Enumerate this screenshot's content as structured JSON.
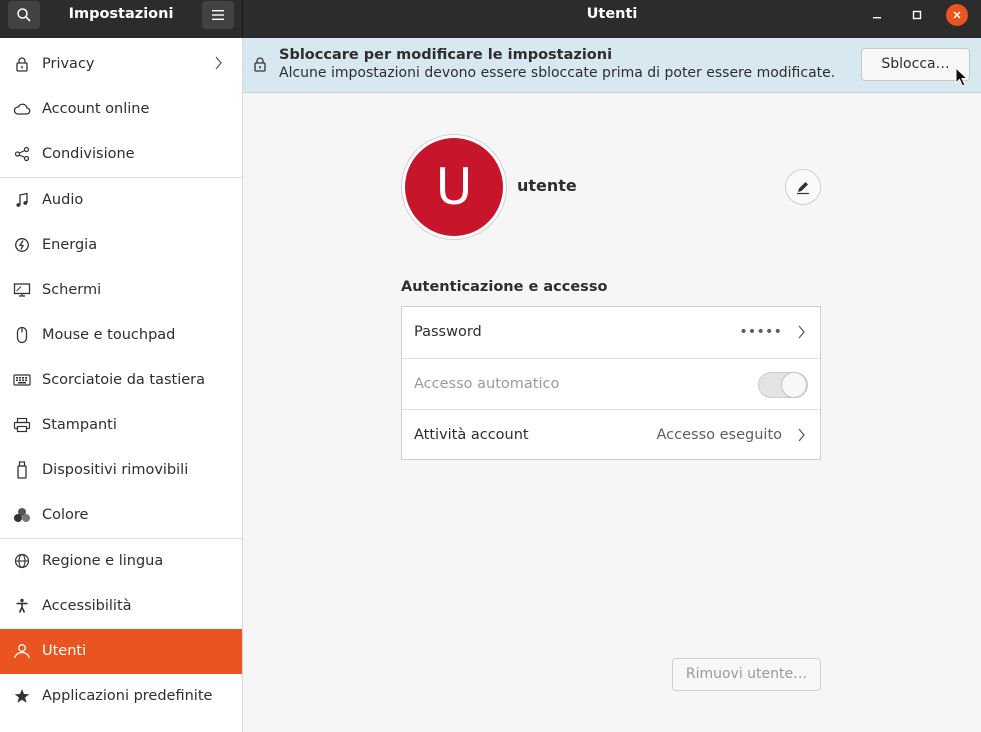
{
  "header": {
    "sidebar_title": "Impostazioni",
    "title": "Utenti",
    "search_icon": "search-icon",
    "menu_icon": "hamburger-menu-icon"
  },
  "sidebar": {
    "items": [
      {
        "label": "Privacy",
        "icon": "lock-icon",
        "has_chevron": true
      },
      {
        "label": "Account online",
        "icon": "cloud-icon"
      },
      {
        "label": "Condivisione",
        "icon": "share-icon"
      },
      {
        "label": "Audio",
        "icon": "music-note-icon"
      },
      {
        "label": "Energia",
        "icon": "power-icon"
      },
      {
        "label": "Schermi",
        "icon": "display-icon"
      },
      {
        "label": "Mouse e touchpad",
        "icon": "mouse-icon"
      },
      {
        "label": "Scorciatoie da tastiera",
        "icon": "keyboard-icon"
      },
      {
        "label": "Stampanti",
        "icon": "printer-icon"
      },
      {
        "label": "Dispositivi rimovibili",
        "icon": "usb-drive-icon"
      },
      {
        "label": "Colore",
        "icon": "color-circles-icon"
      },
      {
        "label": "Regione e lingua",
        "icon": "globe-icon"
      },
      {
        "label": "Accessibilità",
        "icon": "accessibility-icon"
      },
      {
        "label": "Utenti",
        "icon": "users-icon",
        "active": true
      },
      {
        "label": "Applicazioni predefinite",
        "icon": "star-icon"
      }
    ]
  },
  "infobar": {
    "title": "Sbloccare per modificare le impostazioni",
    "subtitle": "Alcune impostazioni devono essere sbloccate prima di poter essere modificate.",
    "unlock_label": "Sblocca…"
  },
  "user": {
    "avatar_letter": "U",
    "name": "utente",
    "avatar_color": "#c7162b"
  },
  "auth": {
    "section_title": "Autenticazione e accesso",
    "password_label": "Password",
    "password_value": "•••••",
    "autologin_label": "Accesso automatico",
    "autologin_on": false,
    "activity_label": "Attività account",
    "activity_value": "Accesso eseguito"
  },
  "remove_label": "Rimuovi utente…",
  "colors": {
    "accent": "#e95420",
    "headerbar": "#2c2c2c",
    "infobar": "#d8e8f0"
  }
}
